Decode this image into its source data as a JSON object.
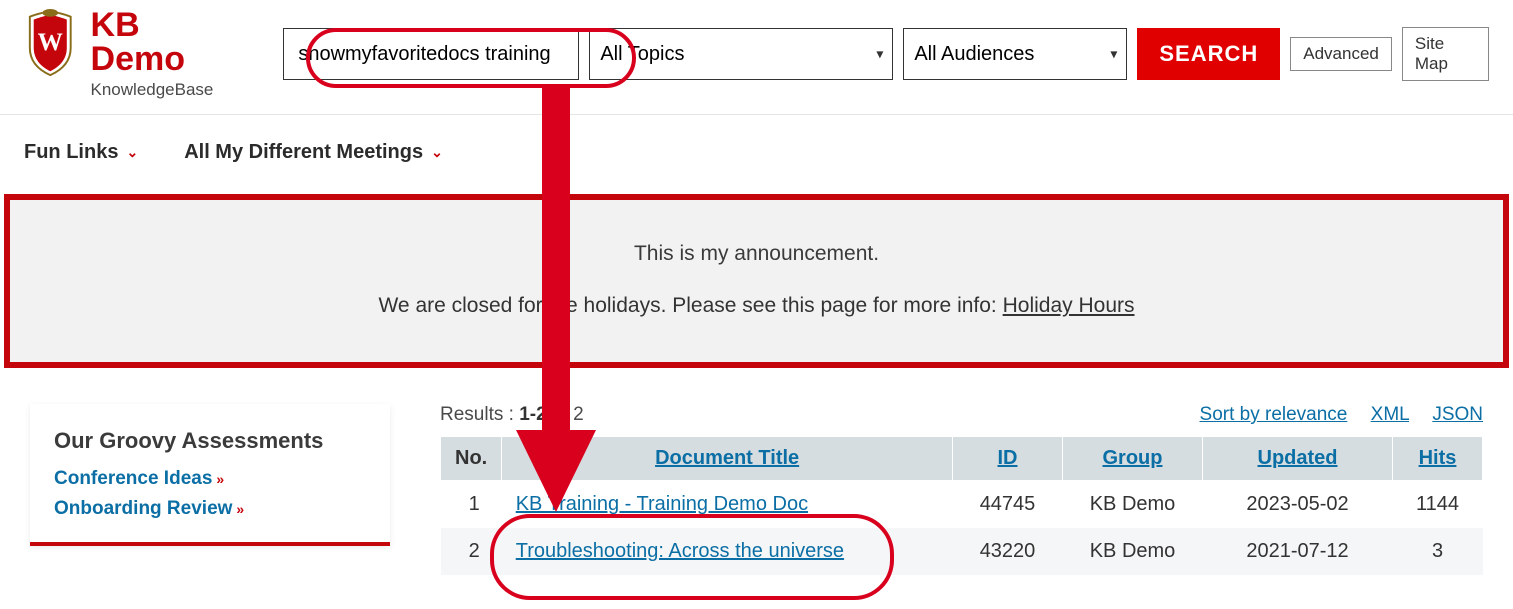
{
  "header": {
    "site_title": "KB Demo",
    "site_subtitle": "KnowledgeBase",
    "search_value": "showmyfavoritedocs training",
    "topics_selected": "All Topics",
    "audiences_selected": "All Audiences",
    "search_button": "SEARCH",
    "advanced": "Advanced",
    "sitemap": "Site Map"
  },
  "nav": {
    "items": [
      {
        "label": "Fun Links"
      },
      {
        "label": "All My Different Meetings"
      }
    ]
  },
  "announcement": {
    "line1": "This is my announcement.",
    "line2_pre": "We are closed for the holidays. Please see this page for more info: ",
    "link_text": "Holiday Hours"
  },
  "sidebar": {
    "heading": "Our Groovy Assessments",
    "links": [
      {
        "label": "Conference Ideas"
      },
      {
        "label": "Onboarding Review"
      }
    ]
  },
  "results_meta": {
    "label_prefix": "Results : ",
    "range": "1-2",
    "label_mid": " of ",
    "total": "2",
    "sort_link": "Sort by relevance",
    "xml": "XML",
    "json": "JSON"
  },
  "table": {
    "headers": {
      "no": "No.",
      "title": "Document Title",
      "id": "ID",
      "group": "Group",
      "updated": "Updated",
      "hits": "Hits"
    },
    "rows": [
      {
        "idx": "1",
        "title": "KB Training - Training Demo Doc",
        "id": "44745",
        "group": "KB Demo",
        "updated": "2023-05-02",
        "hits": "1144"
      },
      {
        "idx": "2",
        "title": "Troubleshooting: Across the universe",
        "id": "43220",
        "group": "KB Demo",
        "updated": "2021-07-12",
        "hits": "3"
      }
    ]
  }
}
